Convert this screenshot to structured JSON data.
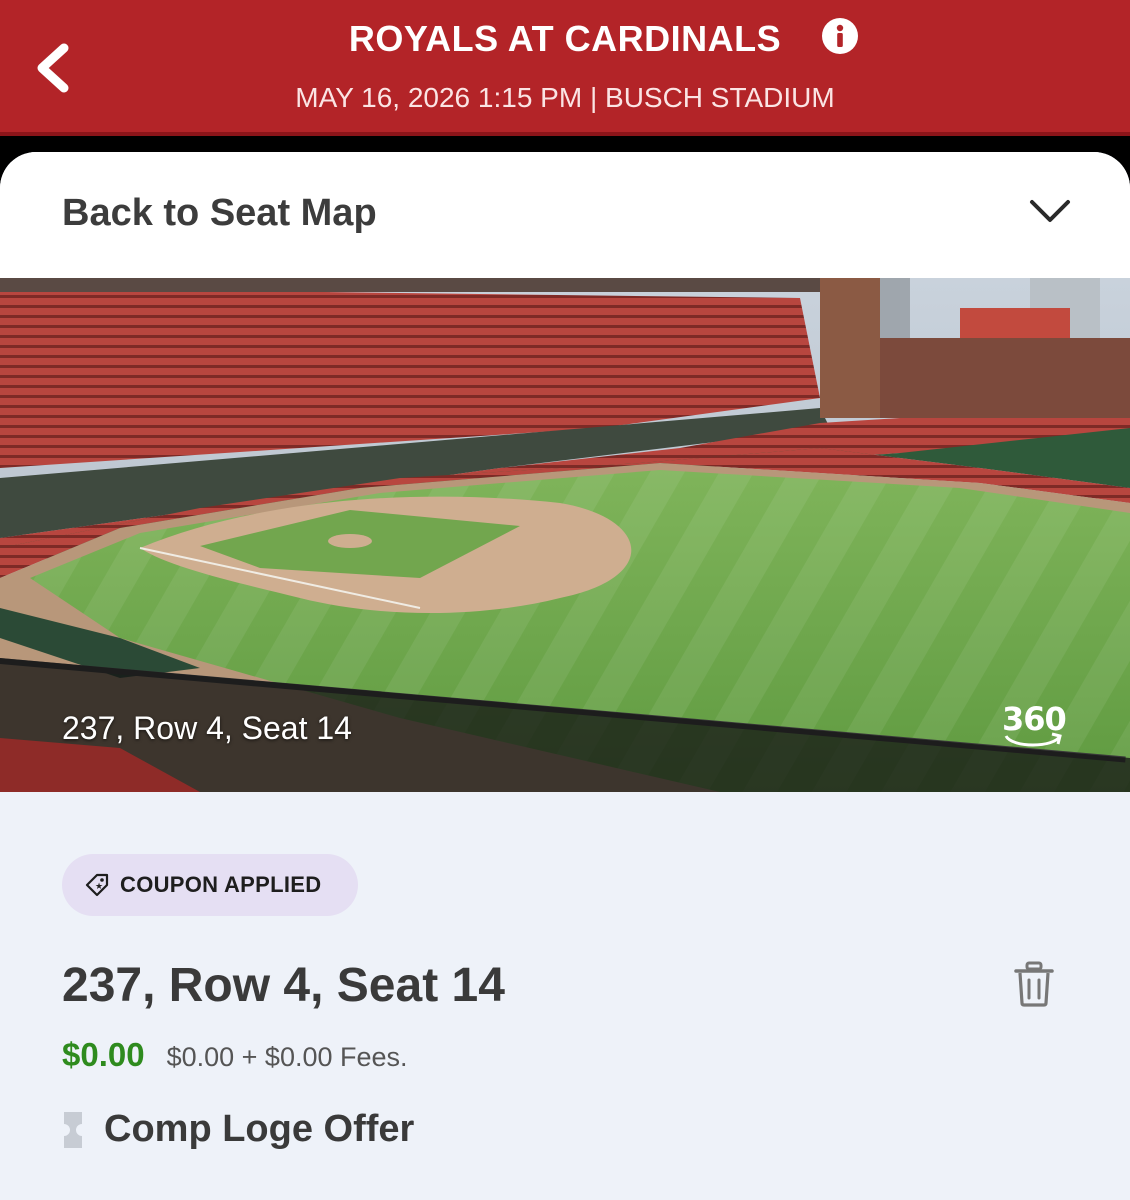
{
  "header": {
    "title": "ROYALS AT CARDINALS",
    "subtitle": "MAY 16, 2026 1:15 PM | BUSCH STADIUM",
    "back_icon": "chevron-left-icon",
    "info_icon": "info-icon",
    "brand_color": "#b32428"
  },
  "seat_panel": {
    "back_label": "Back to Seat Map",
    "collapse_icon": "chevron-down-icon",
    "view_label": "237, Row 4, Seat 14",
    "view_360_label": "360"
  },
  "details": {
    "coupon_label": "COUPON APPLIED",
    "coupon_icon": "tag-icon",
    "seat_title": "237, Row 4, Seat 14",
    "price": "$0.00",
    "price_detail": "$0.00 + $0.00 Fees.",
    "offer_label": "Comp Loge Offer",
    "offer_icon": "ticket-icon",
    "delete_icon": "trash-icon",
    "price_color": "#2e8b1e",
    "coupon_color": "#e5dff3"
  }
}
